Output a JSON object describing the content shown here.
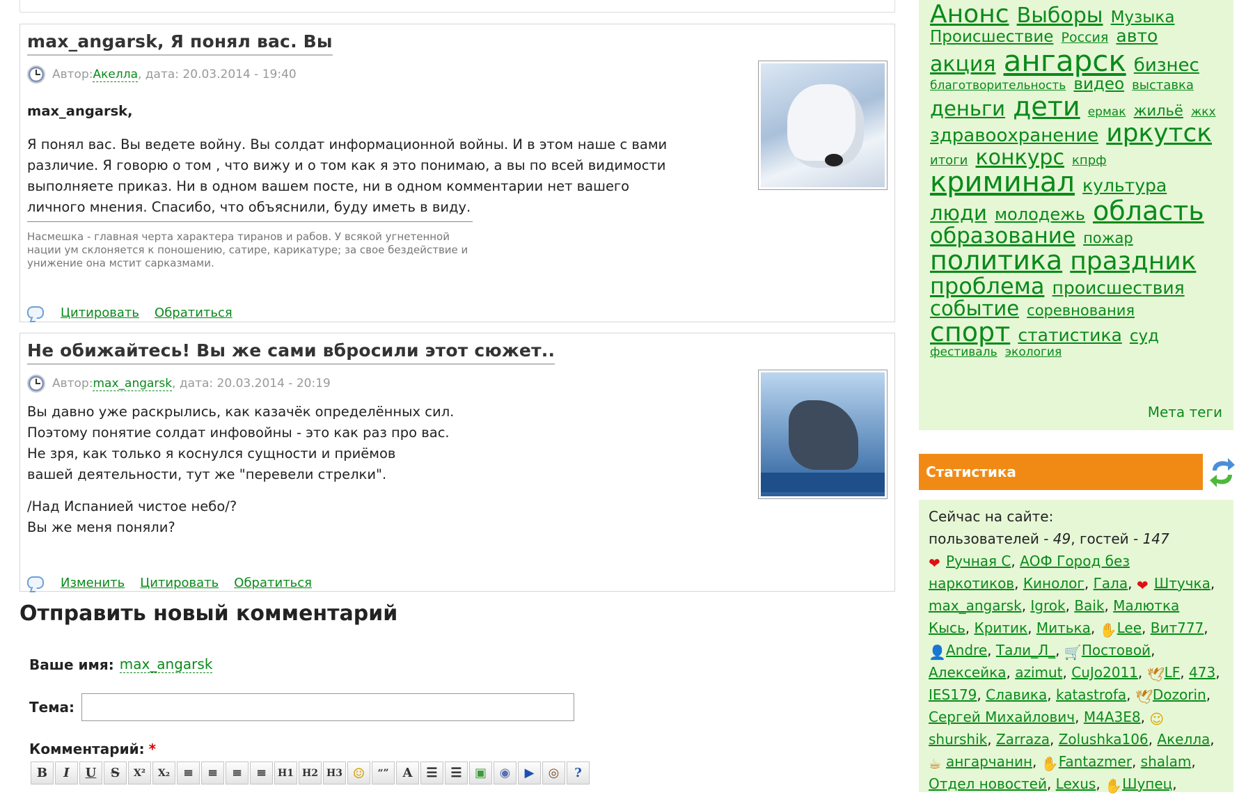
{
  "comments": [
    {
      "title": "max_angarsk, Я понял вас. Вы",
      "meta_prefix": "Автор: ",
      "author": "Акелла",
      "meta_date": ", дата: 20.03.2014 - 19:40",
      "greeting": "max_angarsk,",
      "body": "Я понял вас. Вы ведете войну. Вы солдат информационной войны. И в этом наше с вами различие. Я говорю о том , что вижу и о том как я это понимаю, а вы по всей видимости выполняете приказ. Ни в одном вашем посте, ни в одном комментарии нет вашего личного мнения. Спасибо, что объяснили, буду иметь в виду.",
      "signature": "Насмешка - главная черта характера тиранов и рабов. У всякой угнетенной нации ум склоняется к поношению, сатире, карикатуре; за свое бездействие и унижение она мстит сарказмами.",
      "links": [
        "Цитировать",
        "Обратиться"
      ]
    },
    {
      "title": "Не обижайтесь! Вы же сами вбросили этот сюжет..",
      "meta_prefix": "Автор: ",
      "author": "max_angarsk",
      "meta_date": ", дата: 20.03.2014 - 20:19",
      "lines": [
        "Вы давно уже раскрылись, как казачёк определённых сил.",
        "Поэтому понятие солдат инфовойны - это как раз про вас.",
        "Не зря, как только я коснулся сущности и приёмов",
        "вашей деятельности, тут же \"перевели стрелки\"."
      ],
      "lines2": [
        "/Над Испанией чистое небо/?",
        "Вы же меня поняли?"
      ],
      "links": [
        "Изменить",
        "Цитировать",
        "Обратиться"
      ]
    }
  ],
  "form": {
    "title": "Отправить новый комментарий",
    "name_label": "Ваше имя:",
    "name_value": "max_angarsk",
    "topic_label": "Тема:",
    "topic_value": "",
    "comment_label": "Комментарий:",
    "required_mark": "*",
    "toolbar": [
      {
        "name": "bold-button",
        "label": "B"
      },
      {
        "name": "italic-button",
        "label": "I"
      },
      {
        "name": "underline-button",
        "label": "U"
      },
      {
        "name": "strikethrough-button",
        "label": "S"
      },
      {
        "name": "superscript-button",
        "label": "X²"
      },
      {
        "name": "subscript-button",
        "label": "X₂"
      },
      {
        "name": "align-left-button",
        "label": "≡"
      },
      {
        "name": "align-center-button",
        "label": "≡"
      },
      {
        "name": "align-right-button",
        "label": "≡"
      },
      {
        "name": "justify-button",
        "label": "≡"
      },
      {
        "name": "heading1-button",
        "label": "H1"
      },
      {
        "name": "heading2-button",
        "label": "H2"
      },
      {
        "name": "heading3-button",
        "label": "H3"
      },
      {
        "name": "smiley-button",
        "label": "☺"
      },
      {
        "name": "quote-button",
        "label": "“”"
      },
      {
        "name": "font-color-button",
        "label": "A"
      },
      {
        "name": "numbered-list-button",
        "label": "☰"
      },
      {
        "name": "bulleted-list-button",
        "label": "☰"
      },
      {
        "name": "image-button",
        "label": "▣"
      },
      {
        "name": "link-button",
        "label": "◉"
      },
      {
        "name": "media-button",
        "label": "▶"
      },
      {
        "name": "preview-button",
        "label": "◎"
      },
      {
        "name": "help-button",
        "label": "?"
      }
    ]
  },
  "tags": [
    {
      "t": "Анонс",
      "s": 36
    },
    {
      "t": "Выборы",
      "s": 30
    },
    {
      "t": "Музыка",
      "s": 23
    },
    {
      "t": "Происшествие",
      "s": 23
    },
    {
      "t": "Россия",
      "s": 19
    },
    {
      "t": "авто",
      "s": 25
    },
    {
      "t": "акция",
      "s": 30
    },
    {
      "t": "ангарск",
      "s": 42
    },
    {
      "t": "бизнес",
      "s": 26
    },
    {
      "t": "благотворительность",
      "s": 17
    },
    {
      "t": "видео",
      "s": 23
    },
    {
      "t": "выставка",
      "s": 18
    },
    {
      "t": "деньги",
      "s": 29
    },
    {
      "t": "дети",
      "s": 38
    },
    {
      "t": "ермак",
      "s": 17
    },
    {
      "t": "жильё",
      "s": 21
    },
    {
      "t": "жкх",
      "s": 17
    },
    {
      "t": "здравоохранение",
      "s": 26
    },
    {
      "t": "иркутск",
      "s": 36
    },
    {
      "t": "итоги",
      "s": 18
    },
    {
      "t": "конкурс",
      "s": 30
    },
    {
      "t": "кпрф",
      "s": 18
    },
    {
      "t": "криминал",
      "s": 40
    },
    {
      "t": "культура",
      "s": 25
    },
    {
      "t": "люди",
      "s": 29
    },
    {
      "t": "молодежь",
      "s": 24
    },
    {
      "t": "область",
      "s": 38
    },
    {
      "t": "образование",
      "s": 31
    },
    {
      "t": "пожар",
      "s": 21
    },
    {
      "t": "политика",
      "s": 38
    },
    {
      "t": "праздник",
      "s": 36
    },
    {
      "t": "проблема",
      "s": 32
    },
    {
      "t": "происшествия",
      "s": 25
    },
    {
      "t": "событие",
      "s": 29
    },
    {
      "t": "соревнования",
      "s": 21
    },
    {
      "t": "спорт",
      "s": 38
    },
    {
      "t": "статистика",
      "s": 25
    },
    {
      "t": "суд",
      "s": 23
    },
    {
      "t": "фестиваль",
      "s": 17
    },
    {
      "t": "экология",
      "s": 17
    }
  ],
  "meta_tags_link": "Мета теги",
  "stats": {
    "title": "Статистика",
    "now_label": "Сейчас на сайте:",
    "users_label": "пользователей - ",
    "users_count": "49",
    "guests_label": ", гостей - ",
    "guests_count": "147",
    "users": [
      {
        "n": "Ручная С",
        "i": "heart"
      },
      {
        "n": "АОФ Город без наркотиков"
      },
      {
        "n": "Кинолог"
      },
      {
        "n": "Гала"
      },
      {
        "n": "Штучка",
        "i": "heart"
      },
      {
        "n": "max_angarsk"
      },
      {
        "n": "Igrok"
      },
      {
        "n": "Baik"
      },
      {
        "n": "Малютка Кысь"
      },
      {
        "n": "Критик"
      },
      {
        "n": "Митька"
      },
      {
        "n": "Lee",
        "i": "hand"
      },
      {
        "n": "Вит777"
      },
      {
        "n": "Andre",
        "i": "person"
      },
      {
        "n": "Тали_Л_"
      },
      {
        "n": "Постовой",
        "i": "cart"
      },
      {
        "n": "Алексейка"
      },
      {
        "n": "azimut"
      },
      {
        "n": "CuJo2011"
      },
      {
        "n": "LF",
        "i": "bird"
      },
      {
        "n": "473"
      },
      {
        "n": "IES179"
      },
      {
        "n": "Славика"
      },
      {
        "n": "katastrofa"
      },
      {
        "n": "Dozorin",
        "i": "bird"
      },
      {
        "n": "Сергей Михайлович"
      },
      {
        "n": "M4A3E8"
      },
      {
        "n": "shurshik",
        "i": "face"
      },
      {
        "n": "Zarraza"
      },
      {
        "n": "Zolushka106"
      },
      {
        "n": "Акелла"
      },
      {
        "n": "ангарчанин",
        "i": "cup"
      },
      {
        "n": "Fantazmer",
        "i": "hand"
      },
      {
        "n": "shalam"
      },
      {
        "n": "Отдел новостей"
      },
      {
        "n": "Lexus"
      },
      {
        "n": "Шупец",
        "i": "hand"
      }
    ]
  },
  "colors": {
    "link": "#0a8a1a",
    "sidebar_bg": "#e6f7d6",
    "stat_header": "#f18a14"
  }
}
